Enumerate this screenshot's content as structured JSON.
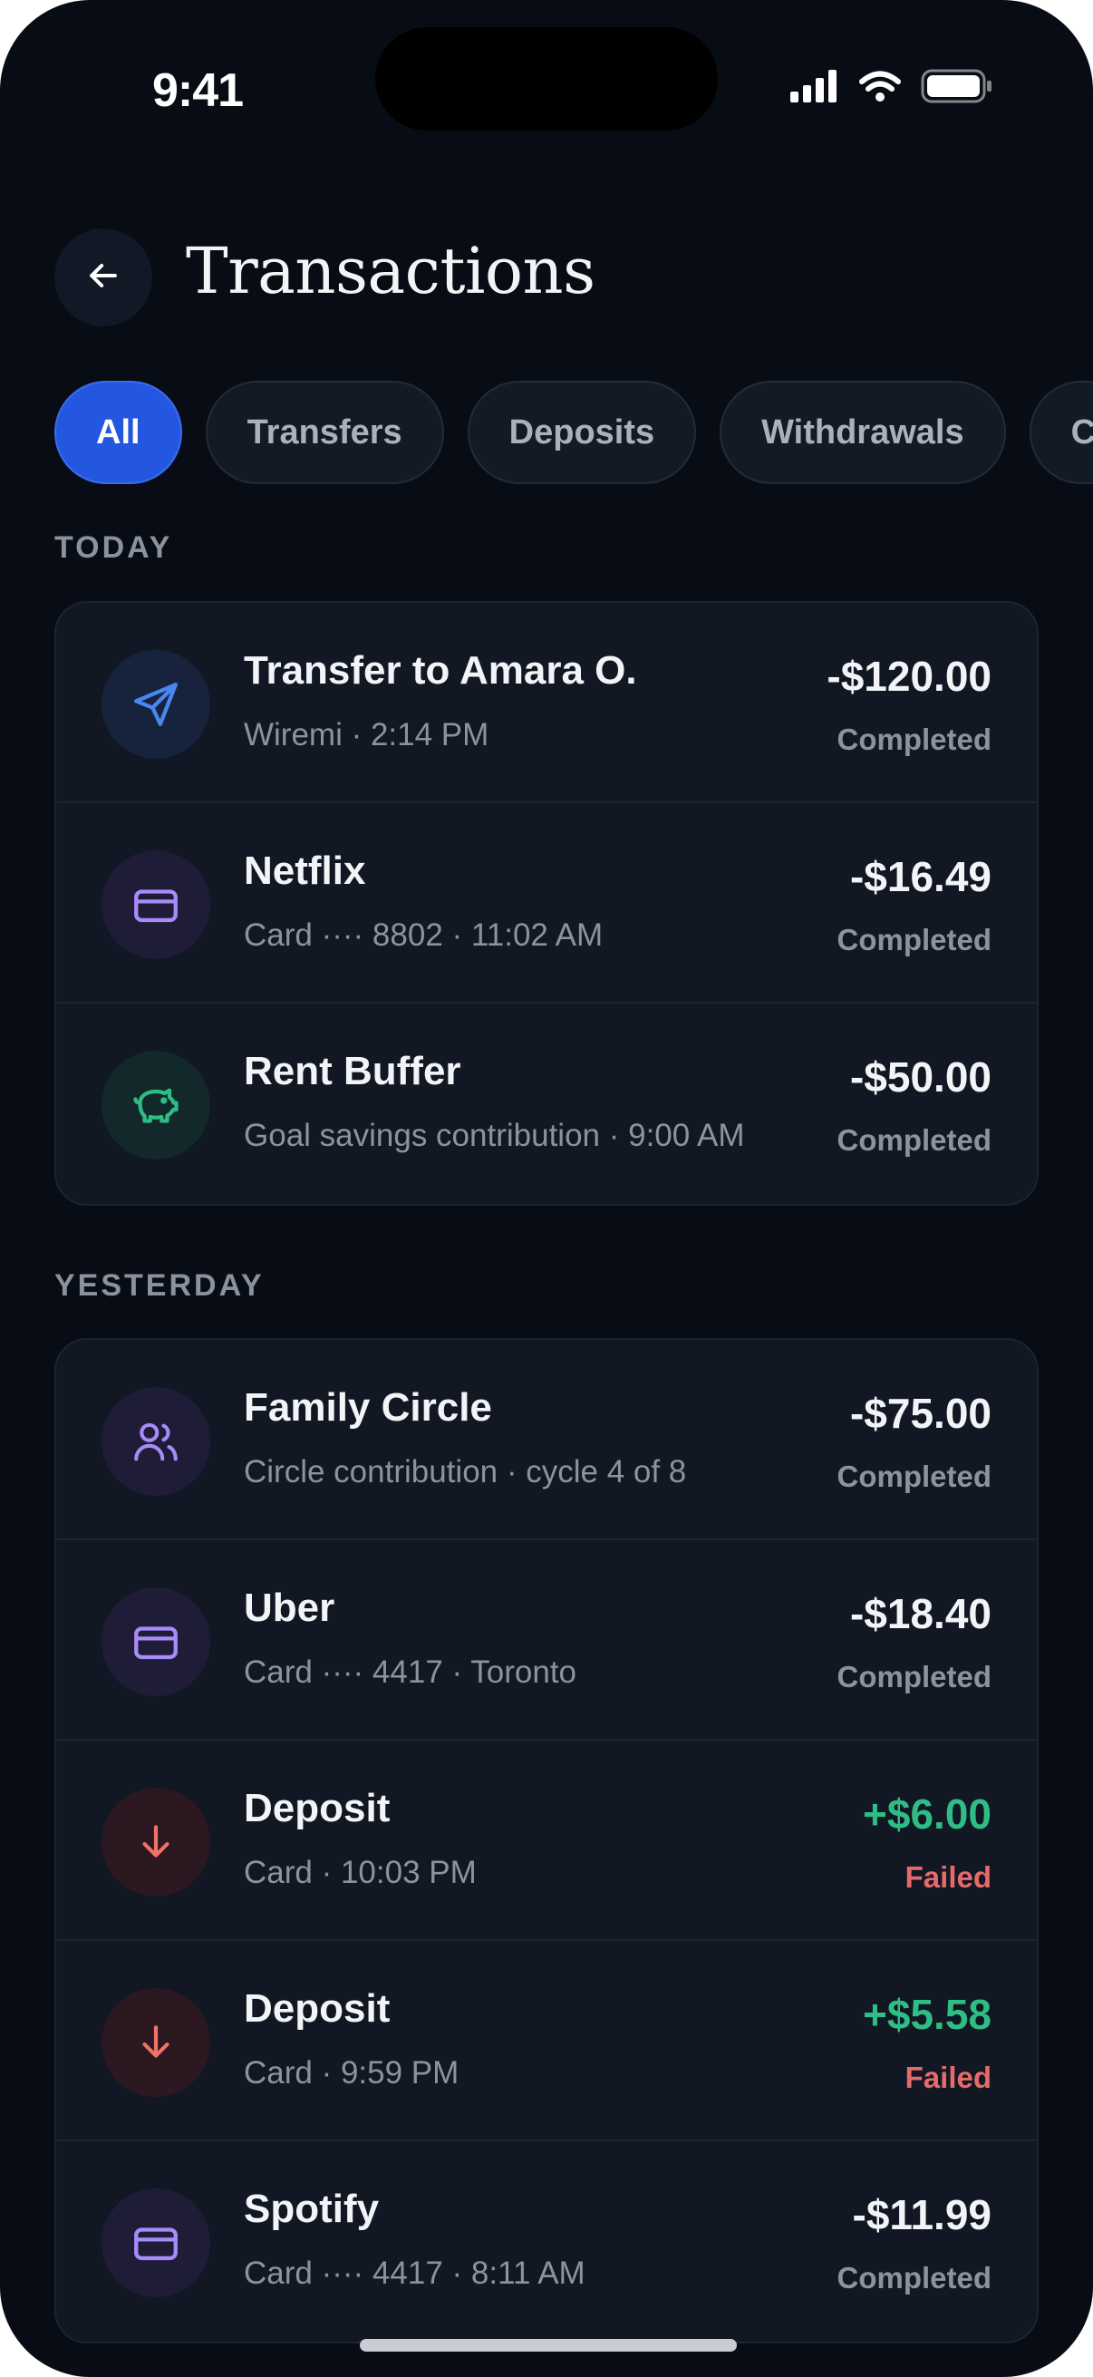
{
  "status_bar": {
    "time": "9:41"
  },
  "header": {
    "title": "Transactions"
  },
  "filters": {
    "items": [
      "All",
      "Transfers",
      "Deposits",
      "Withdrawals",
      "C"
    ],
    "selected": "All"
  },
  "sections": [
    {
      "label": "TODAY",
      "items": [
        {
          "title": "Transfer to Amara O.",
          "subtitle": "Wiremi · 2:14 PM",
          "amount": "-$120.00",
          "status": "Completed",
          "icon": "send-icon"
        },
        {
          "title": "Netflix",
          "subtitle": "Card ···· 8802 · 11:02 AM",
          "amount": "-$16.49",
          "status": "Completed",
          "icon": "card-icon"
        },
        {
          "title": "Rent Buffer",
          "subtitle": "Goal savings contribution · 9:00 AM",
          "amount": "-$50.00",
          "status": "Completed",
          "icon": "piggy-bank-icon"
        }
      ]
    },
    {
      "label": "YESTERDAY",
      "items": [
        {
          "title": "Family Circle",
          "subtitle": "Circle contribution · cycle 4 of 8",
          "amount": "-$75.00",
          "status": "Completed",
          "icon": "users-icon"
        },
        {
          "title": "Uber",
          "subtitle": "Card ···· 4417 · Toronto",
          "amount": "-$18.40",
          "status": "Completed",
          "icon": "card-icon"
        },
        {
          "title": "Deposit",
          "subtitle": "Card · 10:03 PM",
          "amount": "+$6.00",
          "status": "Failed",
          "icon": "arrow-down-icon"
        },
        {
          "title": "Deposit",
          "subtitle": "Card · 9:59 PM",
          "amount": "+$5.58",
          "status": "Failed",
          "icon": "arrow-down-icon"
        },
        {
          "title": "Spotify",
          "subtitle": "Card ···· 4417 · 8:11 AM",
          "amount": "-$11.99",
          "status": "Completed",
          "icon": "card-icon"
        }
      ]
    }
  ],
  "colors": {
    "background": "#080c14",
    "card": "#111723",
    "accent": "#2457e0",
    "positive": "#2ebd85",
    "failed": "#e76a6a"
  }
}
